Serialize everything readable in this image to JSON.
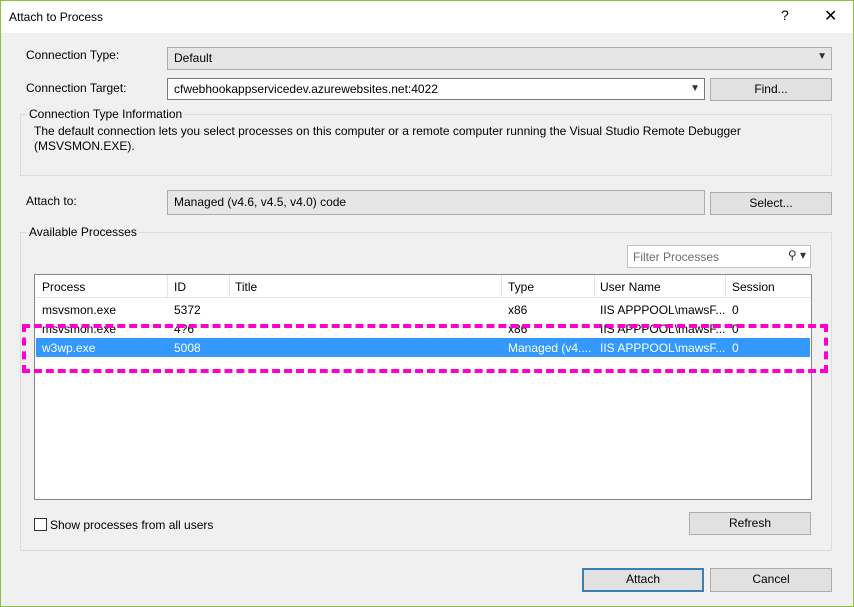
{
  "window": {
    "title": "Attach to Process",
    "help": "?",
    "close": "✕"
  },
  "connection_type": {
    "label": "Connection Type:",
    "value": "Default"
  },
  "connection_target": {
    "label": "Connection Target:",
    "value": "cfwebhookappservicedev.azurewebsites.net:4022",
    "find_label": "Find..."
  },
  "info": {
    "title": "Connection Type Information",
    "text": "The default connection lets you select processes on this computer or a remote computer running the Visual Studio Remote Debugger (MSVSMON.EXE)."
  },
  "attach_to": {
    "label": "Attach to:",
    "value": "Managed (v4.6, v4.5, v4.0) code",
    "select_label": "Select..."
  },
  "available": {
    "title": "Available Processes",
    "filter_placeholder": "Filter Processes",
    "columns": [
      "Process",
      "ID",
      "Title",
      "Type",
      "User Name",
      "Session"
    ],
    "rows": [
      {
        "process": "msvsmon.exe",
        "id": "5372",
        "title": "",
        "type": "x86",
        "user": "IIS APPPOOL\\mawsF...",
        "session": "0"
      },
      {
        "process": "msvsmon.exe",
        "id": "4?6",
        "title": "",
        "type": "x86",
        "user": "IIS APPPOOL\\mawsF...",
        "session": "0"
      },
      {
        "process": "w3wp.exe",
        "id": "5008",
        "title": "",
        "type": "Managed (v4....",
        "user": "IIS APPPOOL\\mawsF...",
        "session": "0"
      }
    ],
    "selected_index": 2,
    "show_all_label": "Show processes from all users",
    "refresh_label": "Refresh"
  },
  "footer": {
    "attach_label": "Attach",
    "cancel_label": "Cancel"
  },
  "colors": {
    "highlight": "#ff00cc",
    "selection": "#3399ff"
  }
}
